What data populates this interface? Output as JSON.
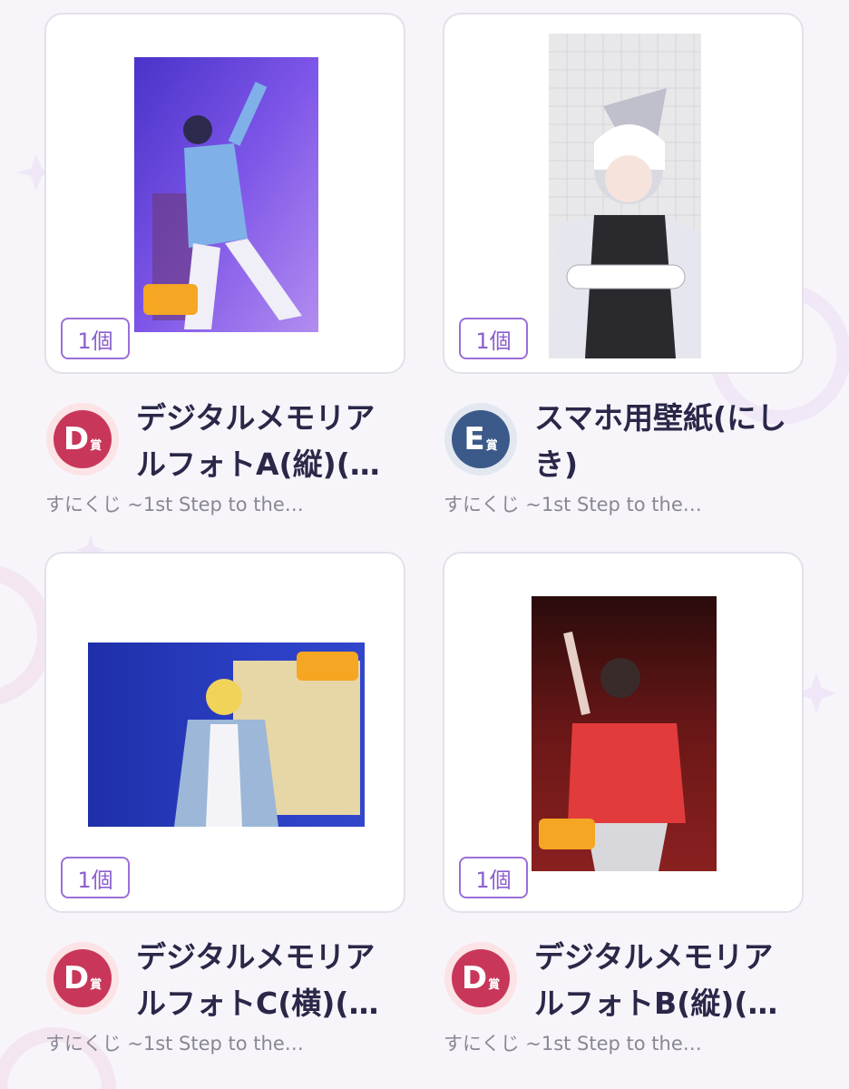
{
  "colors": {
    "background": "#f7f5fa",
    "card_border": "#e4e0ea",
    "quantity_accent": "#8c5fcf",
    "title_text": "#2a2748",
    "sub_text": "#8a8795",
    "prize_d": "#c8375a",
    "prize_e": "#3b5a8a"
  },
  "items": [
    {
      "quantity": "1個",
      "prize_letter": "D",
      "prize_suffix": "賞",
      "title": "デジタルメモリアルフォトA(縦)(…",
      "subtitle": "すにくじ ~1st Step to the…",
      "image": "live-photo-purple-stage"
    },
    {
      "quantity": "1個",
      "prize_letter": "E",
      "prize_suffix": "賞",
      "title": "スマホ用壁紙(にしき)",
      "subtitle": "すにくじ ~1st Step to the…",
      "image": "illustration-wallpaper-silver-hair"
    },
    {
      "quantity": "1個",
      "prize_letter": "D",
      "prize_suffix": "賞",
      "title": "デジタルメモリアルフォトC(横)(…",
      "subtitle": "すにくじ ~1st Step to the…",
      "image": "live-photo-blue-stage"
    },
    {
      "quantity": "1個",
      "prize_letter": "D",
      "prize_suffix": "賞",
      "title": "デジタルメモリアルフォトB(縦)(…",
      "subtitle": "すにくじ ~1st Step to the…",
      "image": "live-photo-red-stage"
    }
  ]
}
